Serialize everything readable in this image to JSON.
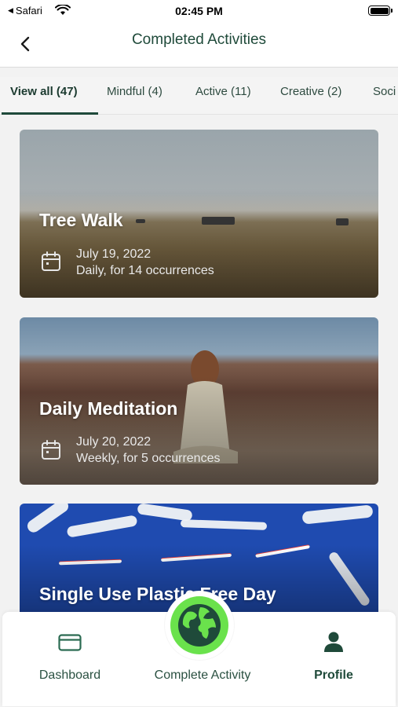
{
  "status_bar": {
    "back_app": "Safari",
    "time": "02:45 PM"
  },
  "header": {
    "title": "Completed Activities"
  },
  "tabs": [
    {
      "label": "View all (47)",
      "active": true
    },
    {
      "label": "Mindful (4)",
      "active": false
    },
    {
      "label": "Active (11)",
      "active": false
    },
    {
      "label": "Creative (2)",
      "active": false
    },
    {
      "label": "Soci",
      "active": false
    }
  ],
  "activities": [
    {
      "title": "Tree Walk",
      "date": "July 19, 2022",
      "frequency": "Daily, for 14 occurrences",
      "icon": "calendar-icon"
    },
    {
      "title": "Daily Meditation",
      "date": "July 20, 2022",
      "frequency": "Weekly, for 5 occurrences",
      "icon": "calendar-icon"
    },
    {
      "title": "Single Use Plastic Free Day",
      "date": "",
      "frequency": "",
      "icon": "calendar-icon"
    }
  ],
  "bottom_nav": {
    "dashboard": "Dashboard",
    "complete_activity": "Complete Activity",
    "profile": "Profile"
  },
  "colors": {
    "brand_dark_green": "#1f4a3a",
    "accent_green": "#6ae24c",
    "background": "#f2f2f2"
  }
}
